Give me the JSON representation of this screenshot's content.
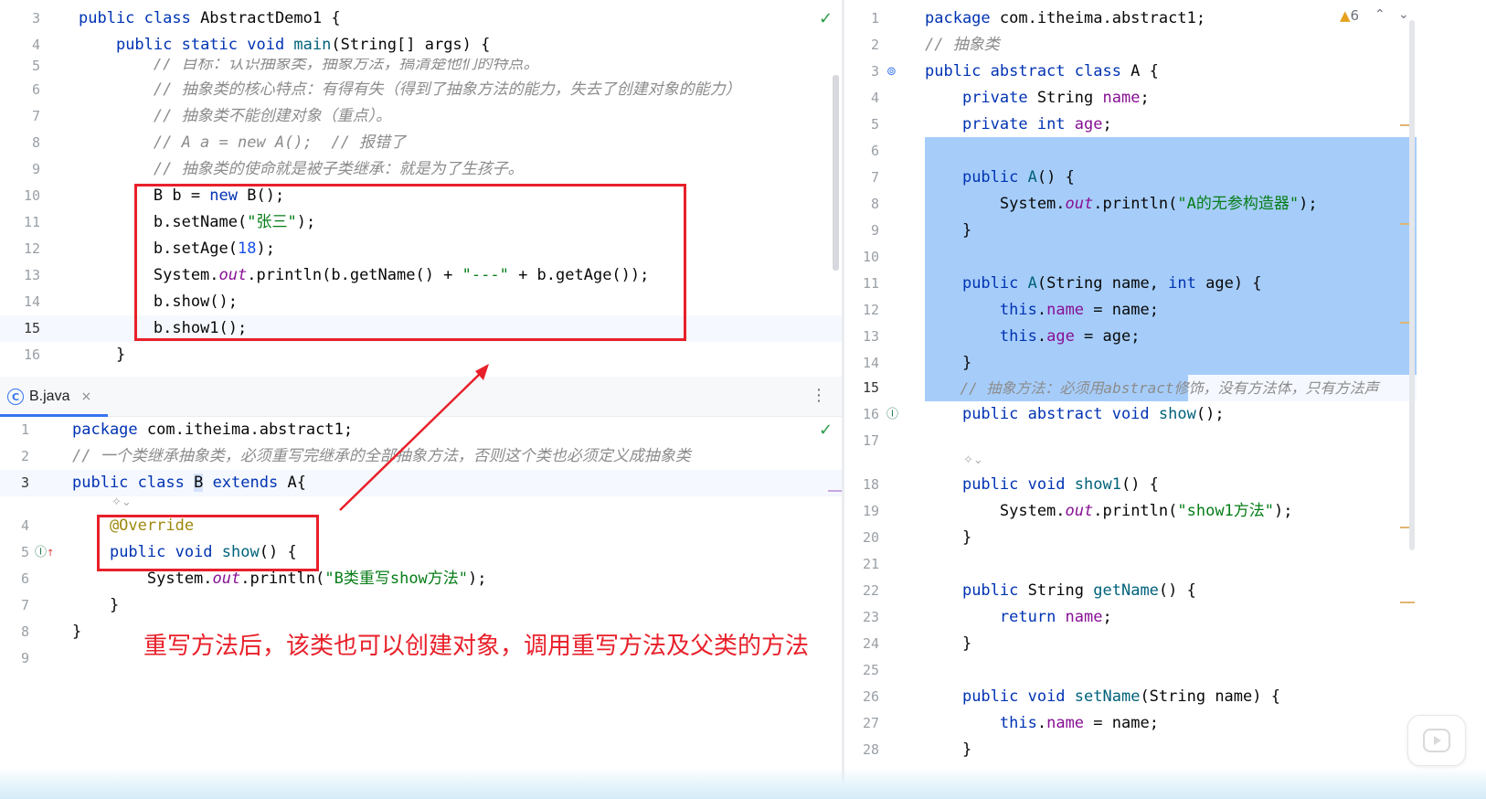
{
  "top_editor": {
    "lines": [
      {
        "n": "3",
        "code": "public class AbstractDemo1 {"
      },
      {
        "n": "4",
        "code": "    public static void main(String[] args) {"
      },
      {
        "n": "5",
        "code": "        // 目标：认识抽象类，抽象方法，搞清楚他们的特点。"
      },
      {
        "n": "6",
        "code": "        // 抽象类的核心特点：有得有失（得到了抽象方法的能力，失去了创建对象的能力）"
      },
      {
        "n": "7",
        "code": "        // 抽象类不能创建对象（重点）。"
      },
      {
        "n": "8",
        "code": "        // A a = new A();  // 报错了"
      },
      {
        "n": "9",
        "code": "        // 抽象类的使命就是被子类继承：就是为了生孩子。"
      },
      {
        "n": "10",
        "code": "        B b = new B();"
      },
      {
        "n": "11",
        "code": "        b.setName(\"张三\");"
      },
      {
        "n": "12",
        "code": "        b.setAge(18);"
      },
      {
        "n": "13",
        "code": "        System.out.println(b.getName() + \"---\" + b.getAge());"
      },
      {
        "n": "14",
        "code": "        b.show();"
      },
      {
        "n": "15",
        "code": "        b.show1();"
      },
      {
        "n": "16",
        "code": "    }"
      }
    ]
  },
  "tab": {
    "icon": "C",
    "label": "B.java",
    "close": "×"
  },
  "bottom_editor": {
    "lines": [
      {
        "n": "1",
        "code": "package com.itheima.abstract1;"
      },
      {
        "n": "2",
        "code": "// 一个类继承抽象类，必须重写完继承的全部抽象方法，否则这个类也必须定义成抽象类"
      },
      {
        "n": "3",
        "code": "public class B extends A{"
      },
      {
        "n": "4",
        "code": "    @Override"
      },
      {
        "n": "5",
        "code": "    public void show() {"
      },
      {
        "n": "6",
        "code": "        System.out.println(\"B类重写show方法\");"
      },
      {
        "n": "7",
        "code": "    }"
      },
      {
        "n": "8",
        "code": "}"
      },
      {
        "n": "9",
        "code": ""
      }
    ]
  },
  "right_editor": {
    "inspection": {
      "count": "6"
    },
    "lines": [
      {
        "n": "1",
        "code": "package com.itheima.abstract1;"
      },
      {
        "n": "2",
        "code": "// 抽象类"
      },
      {
        "n": "3",
        "code": "public abstract class A {"
      },
      {
        "n": "4",
        "code": "    private String name;"
      },
      {
        "n": "5",
        "code": "    private int age;"
      },
      {
        "n": "6",
        "code": ""
      },
      {
        "n": "7",
        "code": "    public A() {"
      },
      {
        "n": "8",
        "code": "        System.out.println(\"A的无参构造器\");"
      },
      {
        "n": "9",
        "code": "    }"
      },
      {
        "n": "10",
        "code": ""
      },
      {
        "n": "11",
        "code": "    public A(String name, int age) {"
      },
      {
        "n": "12",
        "code": "        this.name = name;"
      },
      {
        "n": "13",
        "code": "        this.age = age;"
      },
      {
        "n": "14",
        "code": "    }"
      },
      {
        "n": "15",
        "code": "    // 抽象方法：必须用abstract修饰，没有方法体，只有方法声"
      },
      {
        "n": "16",
        "code": "    public abstract void show();"
      },
      {
        "n": "17",
        "code": ""
      },
      {
        "n": "18",
        "code": "    public void show1() {"
      },
      {
        "n": "19",
        "code": "        System.out.println(\"show1方法\");"
      },
      {
        "n": "20",
        "code": "    }"
      },
      {
        "n": "21",
        "code": ""
      },
      {
        "n": "22",
        "code": "    public String getName() {"
      },
      {
        "n": "23",
        "code": "        return name;"
      },
      {
        "n": "24",
        "code": "    }"
      },
      {
        "n": "25",
        "code": ""
      },
      {
        "n": "26",
        "code": "    public void setName(String name) {"
      },
      {
        "n": "27",
        "code": "        this.name = name;"
      },
      {
        "n": "28",
        "code": "    }"
      }
    ]
  },
  "annotation": "重写方法后，该类也可以创建对象，调用重写方法及父类的方法",
  "colors": {
    "highlight_box": "#e8202a",
    "selection": "#a6cdfa",
    "accent": "#3574f0"
  }
}
